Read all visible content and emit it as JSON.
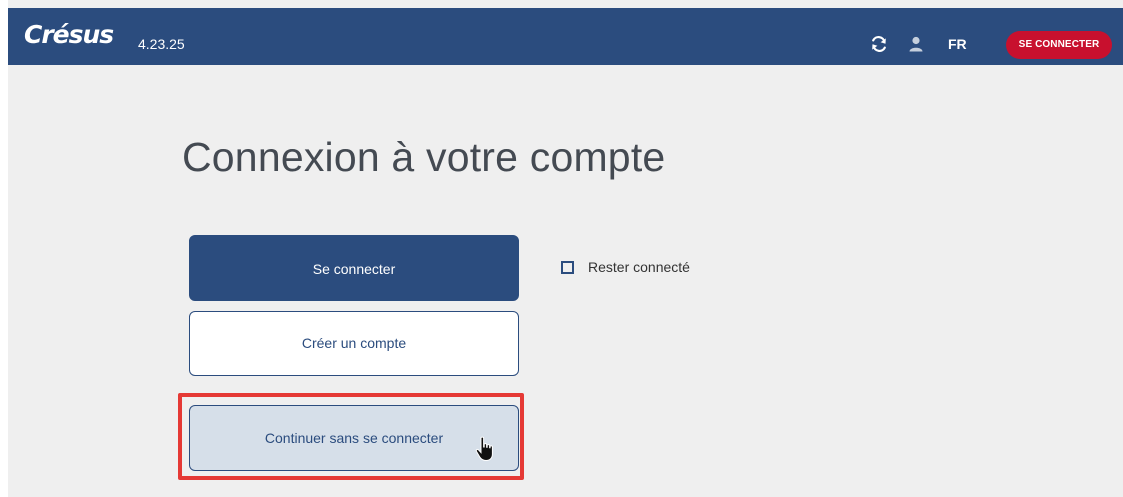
{
  "header": {
    "logo_text": "Crésus",
    "version": "4.23.25",
    "language": "FR",
    "signin_label": "SE CONNECTER",
    "icons": [
      "refresh-icon",
      "user-icon"
    ]
  },
  "main": {
    "title": "Connexion à votre compte",
    "login_button": "Se connecter",
    "create_account_button": "Créer un compte",
    "guest_button": "Continuer sans se connecter",
    "remember_label": "Rester connecté",
    "remember_checked": false
  },
  "colors": {
    "brand_blue": "#2b4c7e",
    "signin_red": "#c8102e",
    "highlight_red": "#e53935",
    "background": "#efefef"
  }
}
